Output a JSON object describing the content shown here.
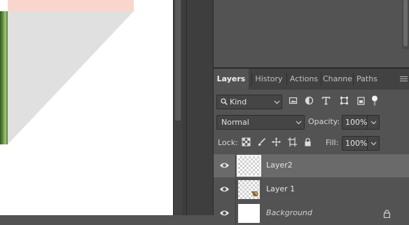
{
  "canvas": {
    "colors": {
      "pink": "#f9d6cc",
      "grey": "#dfe0df",
      "green": "#5f8d3f"
    }
  },
  "layers_panel": {
    "tabs": [
      {
        "label": "Layers",
        "active": true
      },
      {
        "label": "History",
        "active": false
      },
      {
        "label": "Actions",
        "active": false
      },
      {
        "label": "Channe",
        "active": false
      },
      {
        "label": "Paths",
        "active": false
      }
    ],
    "filter": {
      "kind_label": "Kind",
      "icons": [
        "image-filter-icon",
        "adjustment-filter-icon",
        "type-filter-icon",
        "shape-filter-icon",
        "smart-object-filter-icon",
        "filter-toggle-icon"
      ]
    },
    "blend_mode": "Normal",
    "opacity": {
      "label": "Opacity:",
      "value": "100%"
    },
    "lock": {
      "label": "Lock:",
      "icons": [
        "lock-transparency-icon",
        "lock-image-icon",
        "lock-position-icon",
        "lock-artboard-icon",
        "lock-all-icon"
      ]
    },
    "fill": {
      "label": "Fill:",
      "value": "100%"
    },
    "layers": [
      {
        "name": "Layer2",
        "selected": true,
        "visible": true
      },
      {
        "name": "Layer 1",
        "selected": false,
        "visible": true
      },
      {
        "name": "Background",
        "selected": false,
        "visible": true,
        "locked": true
      }
    ]
  }
}
